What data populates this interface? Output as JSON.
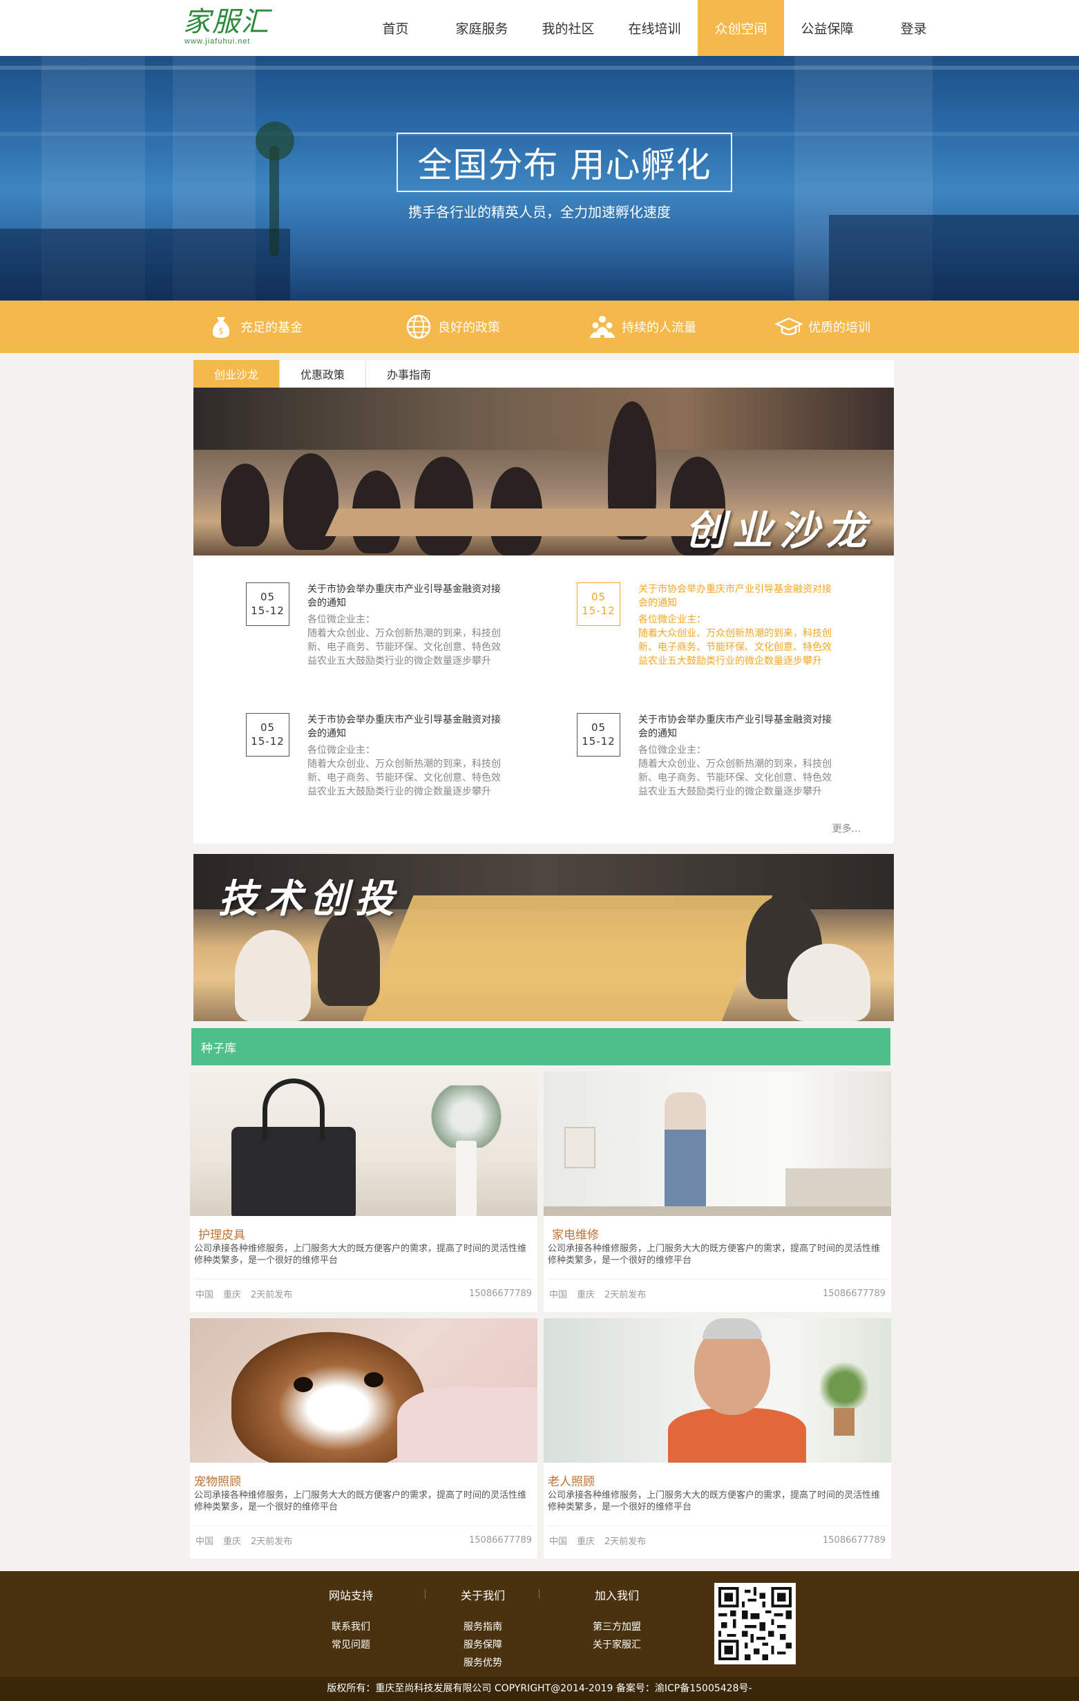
{
  "header": {
    "logo_text": "家服汇",
    "logo_url": "www.jiafuhui.net",
    "nav": [
      {
        "label": "首页"
      },
      {
        "label": "家庭服务"
      },
      {
        "label": "我的社区"
      },
      {
        "label": "在线培训"
      },
      {
        "label": "众创空间",
        "active": true
      },
      {
        "label": "公益保障"
      },
      {
        "label": "登录"
      }
    ]
  },
  "hero": {
    "title": "全国分布 用心孵化",
    "subtitle": "携手各行业的精英人员，全力加速孵化速度"
  },
  "features": [
    {
      "label": "充足的基金",
      "icon": "money-bag-icon"
    },
    {
      "label": "良好的政策",
      "icon": "globe-icon"
    },
    {
      "label": "持续的人流量",
      "icon": "people-icon"
    },
    {
      "label": "优质的培训",
      "icon": "graduation-cap-icon"
    }
  ],
  "tabs": [
    {
      "label": "创业沙龙",
      "active": true
    },
    {
      "label": "优惠政策"
    },
    {
      "label": "办事指南"
    }
  ],
  "salon_banner_text": "创业沙龙",
  "news": [
    {
      "day": "05",
      "date": "15-12",
      "title": "关于市协会举办重庆市产业引导基金融资对接会的通知",
      "body": "各位微企业主：\n随着大众创业、万众创新热潮的到来，科技创新、电子商务、节能环保、文化创意、特色效益农业五大鼓励类行业的微企数量逐步攀升"
    },
    {
      "day": "05",
      "date": "15-12",
      "title": "关于市协会举办重庆市产业引导基金融资对接会的通知",
      "body": "各位微企业主：\n随着大众创业、万众创新热潮的到来，科技创新、电子商务、节能环保、文化创意、特色效益农业五大鼓励类行业的微企数量逐步攀升",
      "highlight": true
    },
    {
      "day": "05",
      "date": "15-12",
      "title": "关于市协会举办重庆市产业引导基金融资对接会的通知",
      "body": "各位微企业主：\n随着大众创业、万众创新热潮的到来，科技创新、电子商务、节能环保、文化创意、特色效益农业五大鼓励类行业的微企数量逐步攀升"
    },
    {
      "day": "05",
      "date": "15-12",
      "title": "关于市协会举办重庆市产业引导基金融资对接会的通知",
      "body": "各位微企业主：\n随着大众创业、万众创新热潮的到来，科技创新、电子商务、节能环保、文化创意、特色效益农业五大鼓励类行业的微企数量逐步攀升"
    }
  ],
  "more_label": "更多...",
  "tech_banner_text": "技术创投",
  "seed": {
    "title": "种子库",
    "cards": [
      {
        "title": "护理皮具",
        "desc": "公司承接各种维修服务，上门服务大大的既方便客户的需求，提高了时间的灵活性维修种类繁多，是一个很好的维修平台",
        "country": "中国",
        "city": "重庆",
        "time": "2天前发布",
        "phone": "15086677789"
      },
      {
        "title": "家电维修",
        "desc": "公司承接各种维修服务，上门服务大大的既方便客户的需求，提高了时间的灵活性维修种类繁多，是一个很好的维修平台",
        "country": "中国",
        "city": "重庆",
        "time": "2天前发布",
        "phone": "15086677789"
      },
      {
        "title": "宠物照顾",
        "desc": "公司承接各种维修服务，上门服务大大的既方便客户的需求，提高了时间的灵活性维修种类繁多，是一个很好的维修平台",
        "country": "中国",
        "city": "重庆",
        "time": "2天前发布",
        "phone": "15086677789"
      },
      {
        "title": "老人照顾",
        "desc": "公司承接各种维修服务，上门服务大大的既方便客户的需求，提高了时间的灵活性维修种类繁多，是一个很好的维修平台",
        "country": "中国",
        "city": "重庆",
        "time": "2天前发布",
        "phone": "15086677789"
      }
    ]
  },
  "footer": {
    "columns": [
      {
        "head": "网站支持",
        "links": [
          "联系我们",
          "常见问题"
        ]
      },
      {
        "head": "关于我们",
        "links": [
          "服务指南",
          "服务保障",
          "服务优势"
        ]
      },
      {
        "head": "加入我们",
        "links": [
          "第三方加盟",
          "关于家服汇"
        ]
      }
    ],
    "copyright": "版权所有：重庆至尚科技发展有限公司 COPYRIGHT@2014-2019 备案号：渝ICP备15005428号-"
  }
}
